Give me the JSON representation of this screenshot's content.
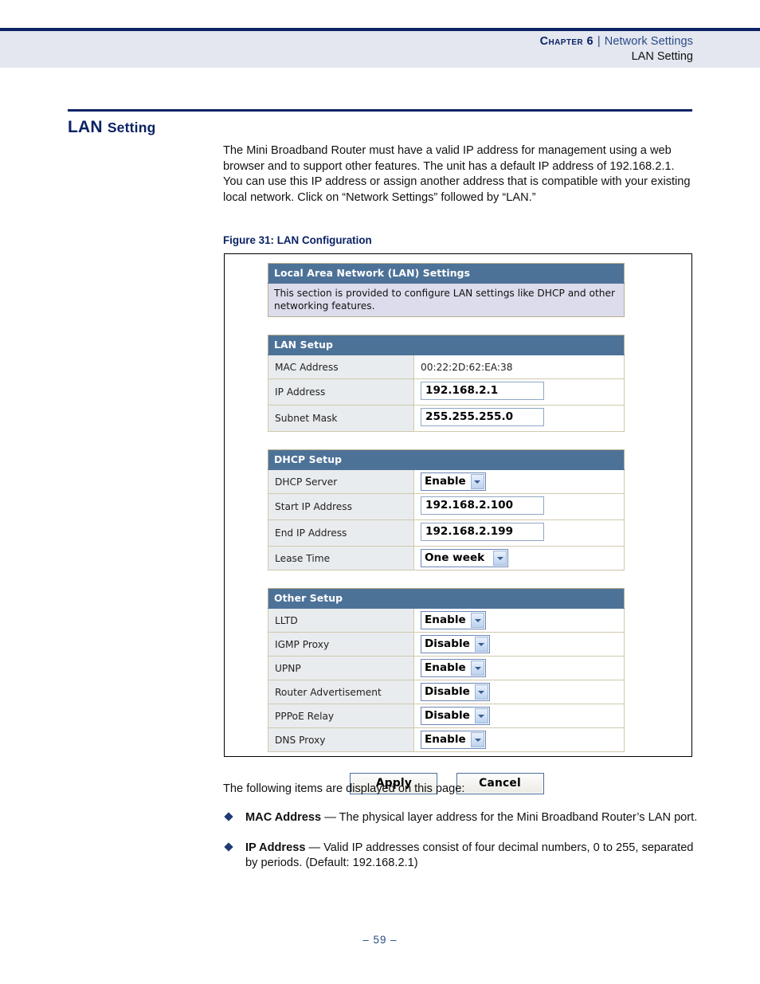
{
  "header": {
    "chapter": "Chapter 6",
    "separator": "|",
    "section": "Network Settings",
    "subsection": "LAN Setting"
  },
  "heading": {
    "main": "LAN",
    "smallcaps": "Setting"
  },
  "intro": {
    "paragraph": "The Mini Broadband Router must have a valid IP address for management using a web browser and to support other features. The unit has a default IP address of 192.168.2.1. You can use this IP address or assign another address that is compatible with your existing local network. Click on “Network Settings” followed by “LAN.”"
  },
  "figure": {
    "caption": "Figure 31:  LAN Configuration",
    "panel": {
      "title_bar": "Local Area Network (LAN) Settings",
      "description": "This section is provided to configure LAN settings like DHCP and other networking features.",
      "sections": [
        {
          "bar": "LAN Setup",
          "rows": [
            {
              "label": "MAC Address",
              "control": "static",
              "value": "00:22:2D:62:EA:38"
            },
            {
              "label": "IP Address",
              "control": "text",
              "value": "192.168.2.1"
            },
            {
              "label": "Subnet Mask",
              "control": "text",
              "value": "255.255.255.0"
            }
          ]
        },
        {
          "bar": "DHCP Setup",
          "rows": [
            {
              "label": "DHCP Server",
              "control": "select",
              "value": "Enable"
            },
            {
              "label": "Start IP Address",
              "control": "text",
              "value": "192.168.2.100"
            },
            {
              "label": "End IP Address",
              "control": "text",
              "value": "192.168.2.199"
            },
            {
              "label": "Lease Time",
              "control": "select",
              "value": "One week"
            }
          ]
        },
        {
          "bar": "Other Setup",
          "rows": [
            {
              "label": "LLTD",
              "control": "select",
              "value": "Enable"
            },
            {
              "label": "IGMP Proxy",
              "control": "select",
              "value": "Disable"
            },
            {
              "label": "UPNP",
              "control": "select",
              "value": "Enable"
            },
            {
              "label": "Router Advertisement",
              "control": "select",
              "value": "Disable"
            },
            {
              "label": "PPPoE Relay",
              "control": "select",
              "value": "Disable"
            },
            {
              "label": "DNS Proxy",
              "control": "select",
              "value": "Enable"
            }
          ]
        }
      ],
      "buttons": {
        "apply": "Apply",
        "cancel": "Cancel"
      }
    }
  },
  "items": {
    "lead": "The following items are displayed on this page:",
    "list": [
      {
        "term": "MAC Address",
        "dash": " — ",
        "description": "The physical layer address for the Mini Broadband Router’s LAN port."
      },
      {
        "term": "IP Address",
        "dash": " — ",
        "description": "Valid IP addresses consist of four decimal numbers, 0 to 255, separated by periods. (Default: 192.168.2.1)"
      }
    ]
  },
  "footer": {
    "page_number": "–  59  –"
  },
  "colors": {
    "navy": "#0b2265",
    "link_blue": "#2a4a86",
    "panel_bar": "#4d7298",
    "panel_desc": "#dcdcec",
    "label_cell": "#e9ecee",
    "header_band": "#e4e7f0"
  }
}
